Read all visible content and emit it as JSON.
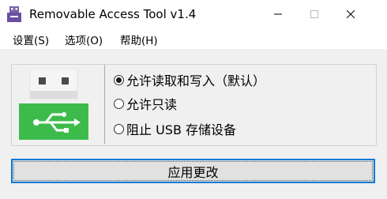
{
  "window": {
    "title": "Removable Access Tool v1.4",
    "controls": {
      "minimize": "minimize-icon",
      "maximize": "maximize-icon",
      "close": "close-icon"
    }
  },
  "menu": {
    "items": [
      {
        "label": "设置(S)"
      },
      {
        "label": "选项(O)"
      },
      {
        "label": "帮助(H)"
      }
    ]
  },
  "options": {
    "radios": [
      {
        "label": "允许读取和写入（默认）",
        "checked": true
      },
      {
        "label": "允许只读",
        "checked": false
      },
      {
        "label": "阻止 USB 存储设备",
        "checked": false
      }
    ]
  },
  "actions": {
    "apply_label": "应用更改"
  },
  "illustration": {
    "icon": "usb-drive-icon",
    "accent_color": "#3dbb4a"
  }
}
